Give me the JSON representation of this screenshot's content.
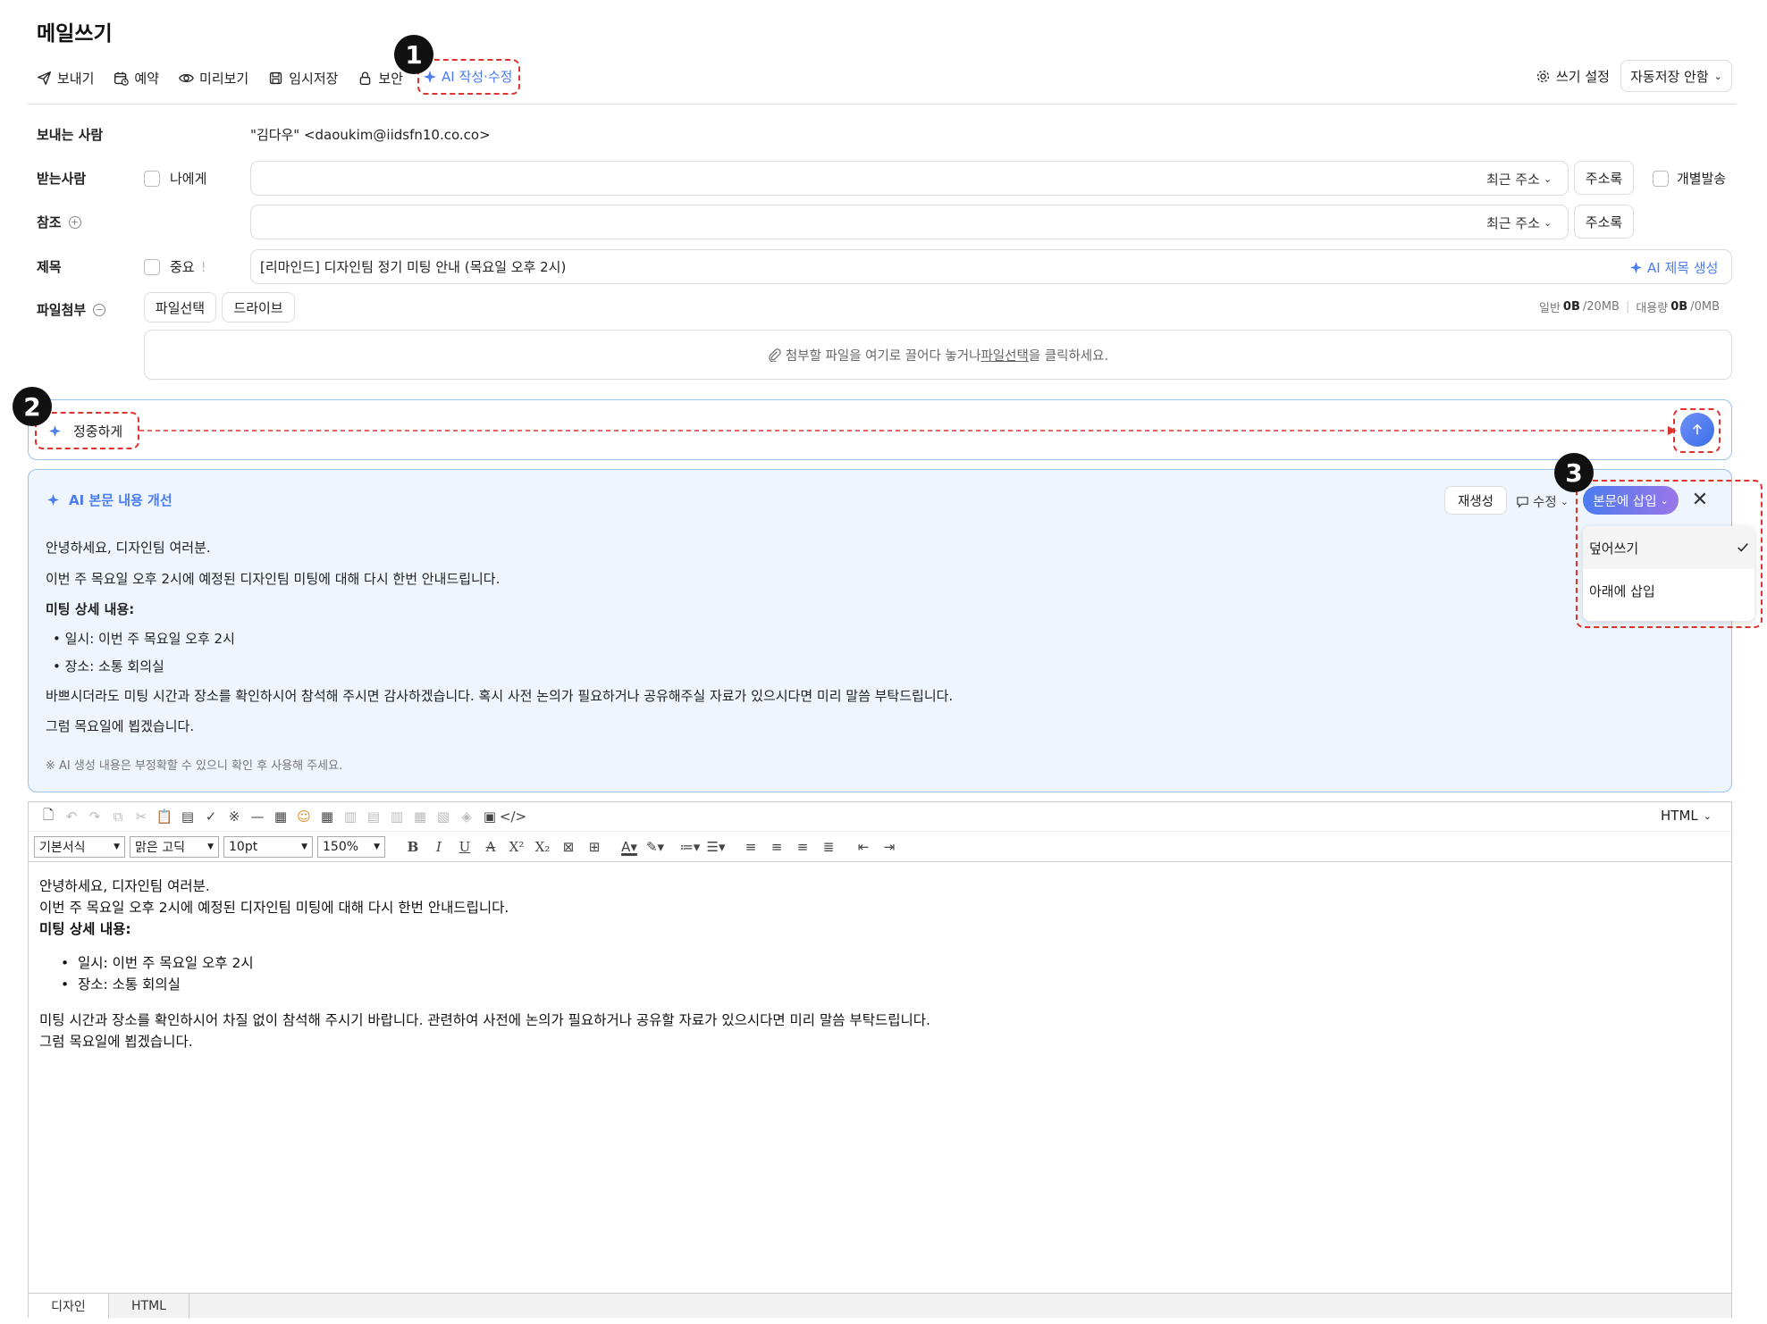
{
  "page": {
    "title": "메일쓰기"
  },
  "toolbar": {
    "send": "보내기",
    "schedule": "예약",
    "preview": "미리보기",
    "draft": "임시저장",
    "security": "보안",
    "ai_write": "AI 작성·수정",
    "write_settings": "쓰기 설정",
    "autosave": "자동저장 안함"
  },
  "form": {
    "sender_label": "보내는 사람",
    "sender_value": "\"김다우\" <daoukim@iidsfn10.co.co>",
    "to_label": "받는사람",
    "to_me": "나에게",
    "recent": "최근 주소",
    "address_book": "주소록",
    "individual": "개별발송",
    "cc_label": "참조",
    "subject_label": "제목",
    "important": "중요",
    "subject_value": "[리마인드] 디자인팀 정기 미팅 안내 (목요일 오후 2시)",
    "ai_subject": "AI 제목 생성",
    "attach_label": "파일첨부",
    "file_select": "파일선택",
    "drive": "드라이브",
    "quota_general_label": "일반",
    "quota_general_used": "0B",
    "quota_general_total": "/20MB",
    "quota_large_label": "대용량",
    "quota_large_used": "0B",
    "quota_large_total": "/0MB",
    "drop_text_a": "첨부할 파일을 여기로 끌어다 놓거나 ",
    "drop_link": "파일선택",
    "drop_text_b": "을 클릭하세요."
  },
  "ai_prompt": {
    "tone": "정중하게"
  },
  "badges": [
    "1",
    "2",
    "3"
  ],
  "ai_panel": {
    "title": "AI 본문 내용 개선",
    "regenerate": "재생성",
    "edit": "수정",
    "insert": "본문에 삽입",
    "greeting": "안녕하세요, 디자인팀 여러분.",
    "line1": "이번 주 목요일 오후 2시에 예정된 디자인팀 미팅에 대해 다시 한번 안내드립니다.",
    "details_title": "미팅 상세 내용:",
    "items": [
      "일시: 이번 주 목요일 오후 2시",
      "장소: 소통 회의실"
    ],
    "line2": "바쁘시더라도 미팅 시간과 장소를 확인하시어 참석해 주시면 감사하겠습니다. 혹시 사전 논의가 필요하거나 공유해주실 자료가 있으시다면 미리 말씀 부탁드립니다.",
    "closing": "그럼 목요일에 뵙겠습니다.",
    "disclaimer": "※ AI 생성 내용은 부정확할 수 있으니 확인 후 사용해 주세요."
  },
  "insert_menu": {
    "overwrite": "덮어쓰기",
    "insert_below": "아래에 삽입"
  },
  "editor": {
    "mode": "HTML",
    "style_select": "기본서식",
    "font_select": "맑은 고딕",
    "size_select": "10pt",
    "line_select": "150%",
    "body": {
      "greeting": "안녕하세요, 디자인팀 여러분.",
      "line1": "이번 주 목요일 오후 2시에 예정된 디자인팀 미팅에 대해 다시 한번 안내드립니다.",
      "details_title": "미팅 상세 내용:",
      "items": [
        "일시: 이번 주 목요일 오후 2시",
        "장소: 소통 회의실"
      ],
      "line2": "미팅 시간과 장소를 확인하시어 차질 없이 참석해 주시기 바랍니다. 관련하여 사전에 논의가 필요하거나 공유할 자료가 있으시다면 미리 말씀 부탁드립니다.",
      "closing": "그럼 목요일에 뵙겠습니다."
    },
    "tab_design": "디자인",
    "tab_html": "HTML"
  },
  "colors": {
    "accent": "#4a7cf0",
    "annotation": "#e0322e",
    "panel_bg": "#eef5fd"
  }
}
